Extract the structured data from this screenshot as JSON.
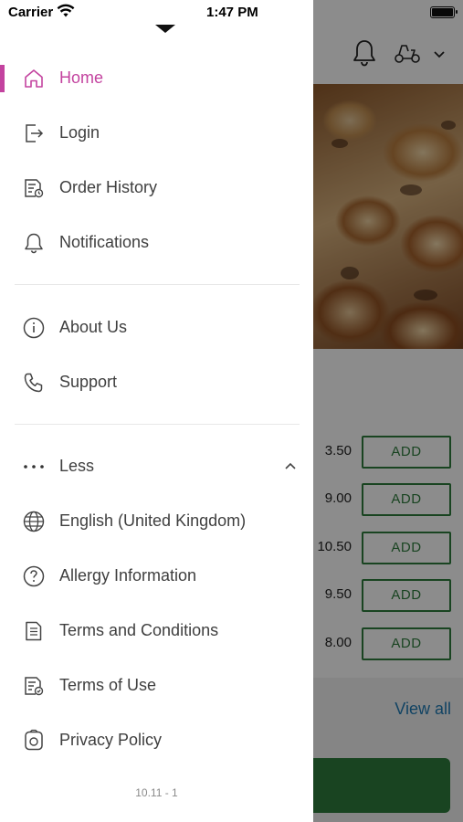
{
  "status_bar": {
    "carrier": "Carrier",
    "time": "1:47 PM"
  },
  "drawer": {
    "primary_items": [
      {
        "label": "Home",
        "icon": "home-icon",
        "active": true
      },
      {
        "label": "Login",
        "icon": "login-icon"
      },
      {
        "label": "Order History",
        "icon": "order-history-icon"
      },
      {
        "label": "Notifications",
        "icon": "bell-icon"
      }
    ],
    "secondary_items": [
      {
        "label": "About Us",
        "icon": "info-icon"
      },
      {
        "label": "Support",
        "icon": "phone-icon"
      }
    ],
    "more_toggle": {
      "label": "Less",
      "icon": "ellipsis-icon",
      "expanded": true
    },
    "extra_items": [
      {
        "label": "English (United Kingdom)",
        "icon": "globe-icon"
      },
      {
        "label": "Allergy Information",
        "icon": "question-icon"
      },
      {
        "label": "Terms and Conditions",
        "icon": "document-icon"
      },
      {
        "label": "Terms of Use",
        "icon": "document-check-icon"
      },
      {
        "label": "Privacy Policy",
        "icon": "privacy-icon"
      }
    ],
    "version": "10.11 - 1"
  },
  "background": {
    "prices": [
      "3.50",
      "9.00",
      "10.50",
      "9.50",
      "8.00"
    ],
    "add_label": "ADD",
    "view_all": "View all"
  },
  "colors": {
    "accent": "#c3439f",
    "text": "#3f3f3f",
    "green": "#2e7d3c",
    "link": "#1f7bb5"
  }
}
